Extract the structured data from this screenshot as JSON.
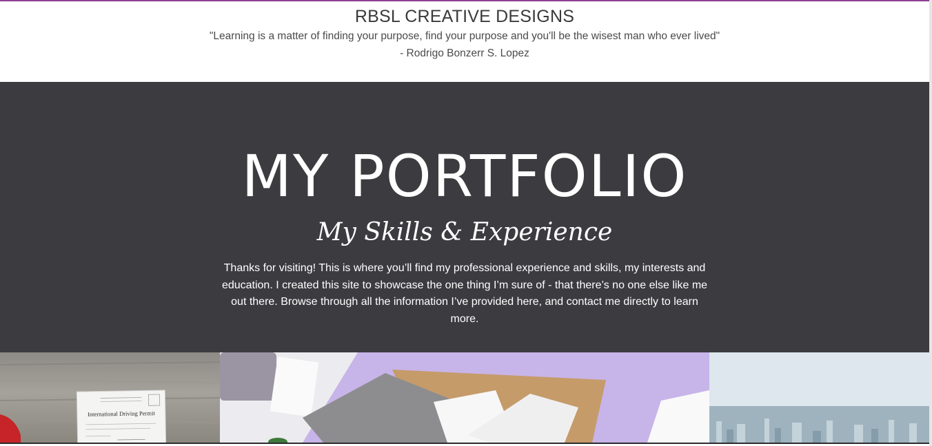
{
  "header": {
    "brand": "RBSL CREATIVE DESIGNS",
    "quote": "\"Learning is a matter of finding your purpose, find your purpose and you'll be the wisest man who ever lived\"",
    "author": "- Rodrigo Bonzerr S. Lopez"
  },
  "hero": {
    "title": "MY PORTFOLIO",
    "subtitle": "My Skills & Experience",
    "text": "Thanks for visiting! This is where you’ll find my professional experience and skills, my interests and education. I created this site to showcase the one thing I’m sure of - that there’s no one else like me out there. Browse through all the information I’ve provided here, and contact me directly to learn more."
  },
  "gallery": {
    "card_title": "International Driving Permit"
  },
  "colors": {
    "accent": "#8e3f91",
    "hero_bg": "#3c3c40"
  }
}
